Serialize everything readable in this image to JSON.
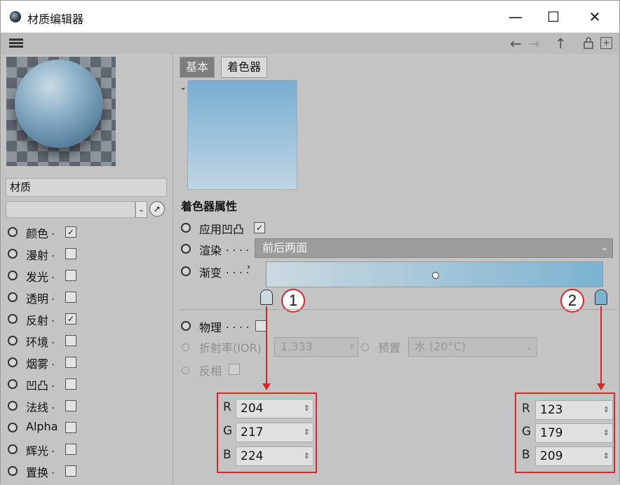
{
  "window": {
    "title": "材质编辑器",
    "min": "—",
    "max": "☐",
    "close": "✕"
  },
  "nav": {
    "back": "←",
    "forward": "→",
    "up": "↑",
    "lock": "🔒",
    "add": "+"
  },
  "material": {
    "name": "材质"
  },
  "channels": [
    {
      "label": "颜色",
      "checked": true
    },
    {
      "label": "漫射",
      "checked": false
    },
    {
      "label": "发光",
      "checked": false
    },
    {
      "label": "透明",
      "checked": false
    },
    {
      "label": "反射",
      "checked": true
    },
    {
      "label": "环境",
      "checked": false
    },
    {
      "label": "烟雾",
      "checked": false
    },
    {
      "label": "凹凸",
      "checked": false
    },
    {
      "label": "法线",
      "checked": false
    },
    {
      "label": "Alpha",
      "checked": false
    },
    {
      "label": "辉光",
      "checked": false
    },
    {
      "label": "置换",
      "checked": false
    }
  ],
  "tabs": {
    "basic": "基本",
    "shader": "着色器"
  },
  "shader": {
    "section_title": "着色器属性",
    "apply_bump": "应用凹凸",
    "render_label": "渲染",
    "render_value": "前后两面",
    "gradient_label": "渐变",
    "physical_label": "物理",
    "ior_label": "折射率(IOR)",
    "ior_value": "1.333",
    "preset_label": "预置",
    "preset_value": "水 (20°C)",
    "invert_label": "反相"
  },
  "dots": ".",
  "dots_long": ". . . .",
  "knot1": {
    "badge": "1",
    "r_label": "R",
    "g_label": "G",
    "b_label": "B",
    "r": "204",
    "g": "217",
    "b": "224"
  },
  "knot2": {
    "badge": "2",
    "r_label": "R",
    "g_label": "G",
    "b_label": "B",
    "r": "123",
    "g": "179",
    "b": "209"
  },
  "colors": {
    "knot1": "#ccd9e0",
    "knot2": "#7bb3d1",
    "accent": "#d9262c"
  }
}
